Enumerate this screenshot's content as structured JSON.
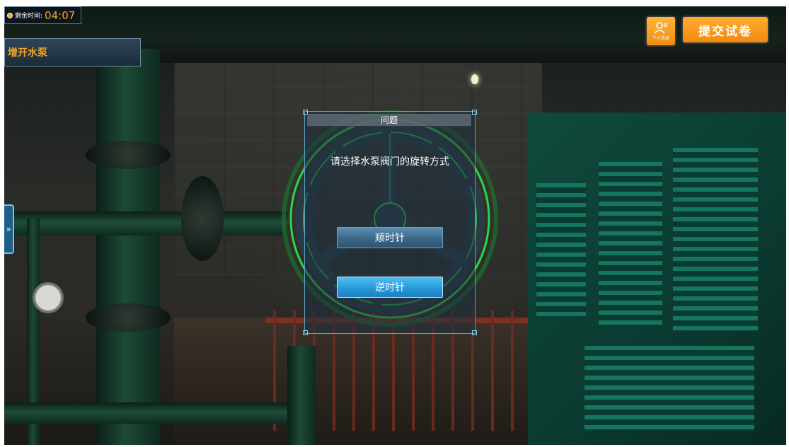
{
  "hud": {
    "timer_label": "剩余时间:",
    "timer_value": "04:07",
    "task_title": "增开水泵",
    "side_toggle": "»",
    "profile_caption": "个人信息",
    "submit_label": "提交试卷"
  },
  "dialog": {
    "title": "问题",
    "question": "请选择水泵阀门的旋转方式",
    "options": [
      "顺时针",
      "逆时针"
    ]
  },
  "colors": {
    "accent_orange": "#f6a623",
    "option_blue": "#2799d8",
    "wheel_green": "#2ad64a"
  }
}
